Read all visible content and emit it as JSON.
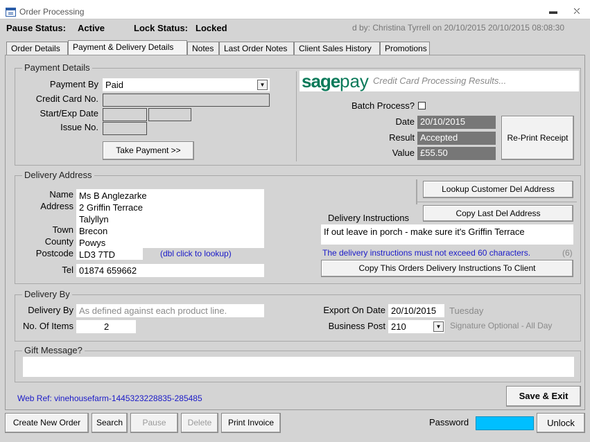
{
  "window": {
    "title": "Order Processing",
    "minimize_symbol": "▬",
    "close_symbol": "⛌"
  },
  "status": {
    "pause_label": "Pause Status:",
    "pause_value": "Active",
    "lock_label": "Lock Status:",
    "lock_value": "Locked",
    "locked_by": "d by: Christina Tyrrell on 20/10/2015 20/10/2015 08:08:30"
  },
  "tabs": [
    "Order Details",
    "Payment & Delivery Details",
    "Notes",
    "Last Order Notes",
    "Client Sales History",
    "Promotions"
  ],
  "payment": {
    "title": "Payment Details",
    "payment_by_label": "Payment By",
    "payment_by_value": "Paid",
    "card_label": "Credit Card No.",
    "card_value": "",
    "startexp_label": "Start/Exp Date",
    "issue_label": "Issue No.",
    "take_payment_label": "Take Payment >>"
  },
  "sagepay": {
    "logo_sage": "sage",
    "logo_pay": "pay",
    "results_title": "Credit Card Processing Results...",
    "batch_label": "Batch Process?",
    "date_label": "Date",
    "date_value": "20/10/2015",
    "result_label": "Result",
    "result_value": "Accepted",
    "value_label": "Value",
    "value_value": "£55.50",
    "reprint_label": "Re-Print Receipt",
    "accent_color": "#0c7a5a"
  },
  "delivery_address": {
    "title": "Delivery Address",
    "name_label": "Name",
    "name_value": "Ms B Anglezarke",
    "address_label": "Address",
    "address_lines": [
      "2 Griffin Terrace",
      "Talyllyn"
    ],
    "town_label": "Town",
    "town_value": "Brecon",
    "county_label": "County",
    "county_value": "Powys",
    "postcode_label": "Postcode",
    "postcode_value": "LD3 7TD",
    "postcode_hint": "(dbl click to lookup)",
    "tel_label": "Tel",
    "tel_value": "01874 659662",
    "lookup_label": "Lookup Customer Del Address",
    "copy_last_label": "Copy Last Del Address",
    "instructions_label": "Delivery Instructions",
    "instructions_value": "If out leave in porch - make sure it's Griffin Terrace",
    "instructions_warning": "The delivery instructions must not exceed 60 characters.",
    "instructions_count": "(6)",
    "copy_instructions_label": "Copy This Orders Delivery Instructions To Client"
  },
  "delivery_by": {
    "title": "Delivery By",
    "delivery_by_label": "Delivery By",
    "delivery_by_value": "As defined against each product line.",
    "items_label": "No. Of Items",
    "items_value": "2",
    "export_label": "Export On Date",
    "export_value": "20/10/2015",
    "export_day": "Tuesday",
    "business_post_label": "Business Post",
    "business_post_value": "210",
    "business_post_desc": "Signature Optional - All Day"
  },
  "gift": {
    "title": "Gift Message?",
    "value": ""
  },
  "web_ref": "Web Ref: vinehousefarm-1445323228835-285485",
  "save_exit_label": "Save & Exit",
  "bottom": {
    "create_label": "Create New Order",
    "search_label": "Search",
    "pause_label": "Pause",
    "delete_label": "Delete",
    "print_label": "Print Invoice",
    "password_label": "Password",
    "unlock_label": "Unlock",
    "password_color": "#00bfff"
  }
}
